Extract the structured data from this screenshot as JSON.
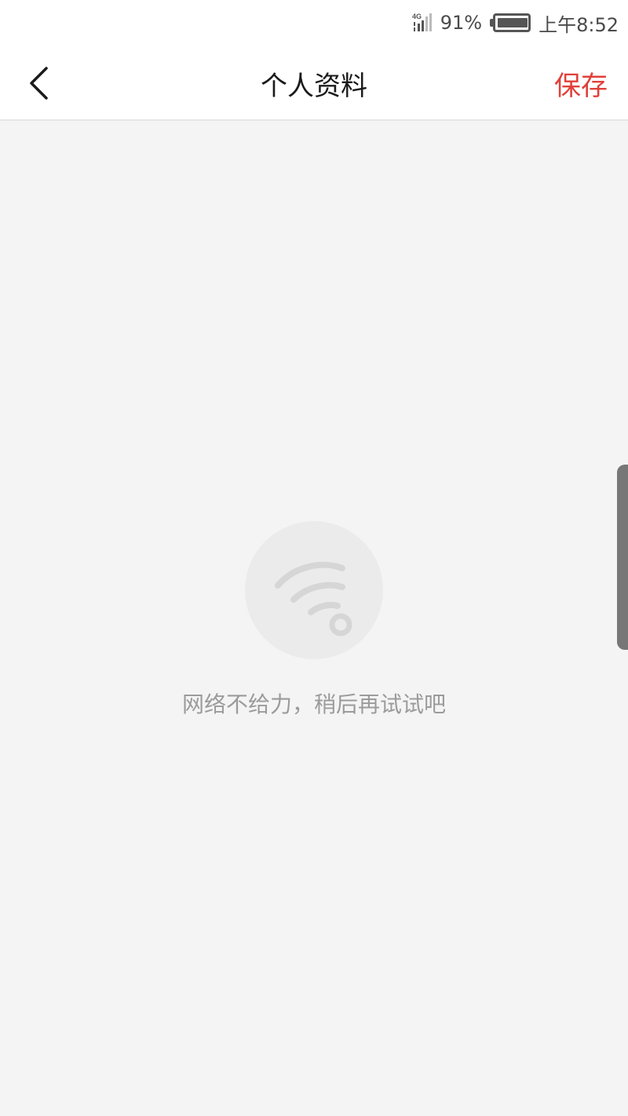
{
  "status_bar": {
    "network_label": "4G",
    "battery_text": "91%",
    "battery_level": 0.91,
    "time": "上午8:52",
    "icons": [
      "signal-4g-icon",
      "battery-icon"
    ]
  },
  "header": {
    "title": "个人资料",
    "save_label": "保存",
    "save_color": "#e0403a",
    "back_icon": "chevron-left-icon"
  },
  "empty_state": {
    "icon": "wifi-icon",
    "message": "网络不给力，稍后再试试吧"
  }
}
